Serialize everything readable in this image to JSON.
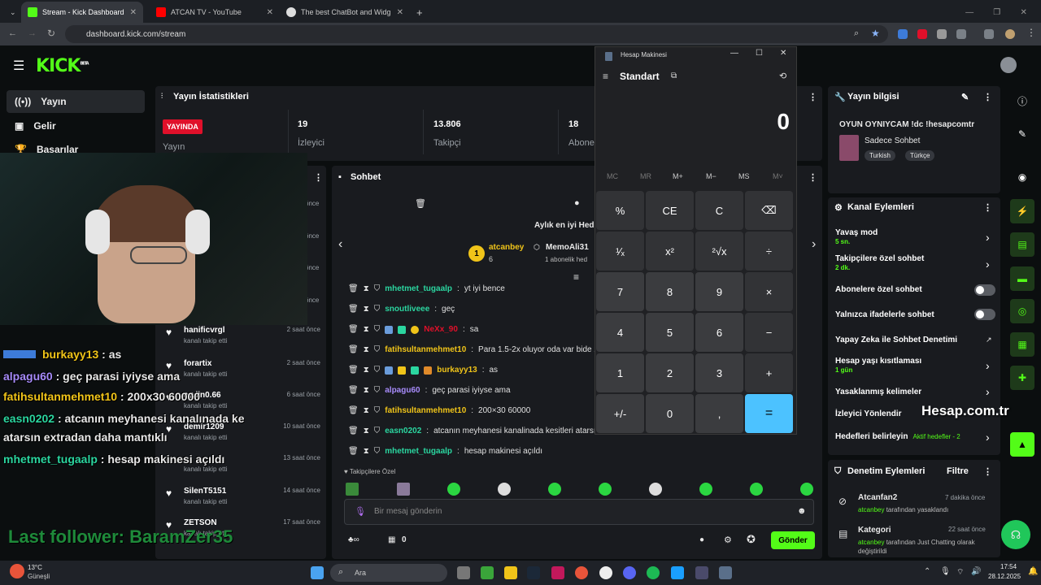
{
  "browser": {
    "tabs": [
      {
        "title": "Stream - Kick Dashboard"
      },
      {
        "title": "ATCAN TV - YouTube"
      },
      {
        "title": "The best ChatBot and Widg"
      }
    ],
    "url": "dashboard.kick.com/stream"
  },
  "kick": {
    "logo": "KICK",
    "logo_sup": "BETA"
  },
  "sidebar": {
    "items": [
      {
        "label": "Yayın",
        "icon": "broadcast-icon"
      },
      {
        "label": "Gelir",
        "icon": "wallet-icon"
      },
      {
        "label": "Başarılar",
        "icon": "trophy-icon"
      }
    ]
  },
  "stats": {
    "title": "Yayın İstatistikleri",
    "live_badge": "YAYINDA",
    "live_label": "Yayın",
    "viewers_value": "19",
    "viewers_label": "İzleyici",
    "followers_value": "13.806",
    "followers_label": "Takipçi",
    "subs_value": "18",
    "subs_label": "Abone"
  },
  "followers": [
    {
      "name": "hanificvrgl",
      "sub": "kanalı takip etti",
      "time": "2 saat önce"
    },
    {
      "name": "forartix",
      "sub": "kanalı takip etti",
      "time": "2 saat önce"
    },
    {
      "name": "aydin0.66",
      "sub": "kanalı takip etti",
      "time": "6 saat önce"
    },
    {
      "name": "demir1209",
      "sub": "kanalı takip etti",
      "time": "10 saat önce"
    },
    {
      "name": "",
      "sub": "kanalı takip etti",
      "time": "13 saat önce"
    },
    {
      "name": "SilenT5151",
      "sub": "kanalı takip etti",
      "time": "14 saat önce"
    },
    {
      "name": "ZETSON",
      "sub": "kanalı takip etti",
      "time": "17 saat önce"
    }
  ],
  "followers_partial_times": [
    "önce",
    "önce",
    "önce",
    "önce"
  ],
  "chat": {
    "title": "Sohbet",
    "top_gifter_title": "Aylık en iyi Hed",
    "gifter1_name": "atcanbey",
    "gifter1_count": "6",
    "gifter2_name": "MemoAli31",
    "gifter2_sub": "1 abonelik hed",
    "messages": [
      {
        "user": "mhetmet_tugaalp",
        "text": "yt iyi bence",
        "color": "#2bd6a0"
      },
      {
        "user": "snoutliveee",
        "text": "geç",
        "color": "#2bd6a0"
      },
      {
        "user": "NeXx_90",
        "text": "sa",
        "color": "#e0102a"
      },
      {
        "user": "fatihsultanmehmet10",
        "text": "Para 1.5-2x oluyor oda var bide 2",
        "color": "#f0c419"
      },
      {
        "user": "burkayy13",
        "text": "as",
        "color": "#f0c419"
      },
      {
        "user": "alpagu60",
        "text": "geç parasi iyiyse ama",
        "color": "#a78bfa"
      },
      {
        "user": "fatihsultanmehmet10",
        "text": "200×30 60000",
        "color": "#f0c419"
      },
      {
        "user": "easn0202",
        "text": "atcanın meyhanesi kanalinada kesitleri atarsı",
        "color": "#2bd6a0"
      },
      {
        "user": "mhetmet_tugaalp",
        "text": "hesap makinesi açıldı",
        "color": "#2bd6a0"
      }
    ],
    "followers_only_label": "Takipçilere Özel",
    "input_placeholder": "Bir mesaj gönderin",
    "points": "0",
    "send_label": "Gönder"
  },
  "overlay": {
    "lines": [
      {
        "user": "burkayy13",
        "text": " : as",
        "color": "#f0c419"
      },
      {
        "user": "alpagu60",
        "text": " : geç parasi iyiyse ama",
        "color": "#a78bfa"
      },
      {
        "user": "fatihsultanmehmet10",
        "text": " : 200x30 60000",
        "color": "#f0c419"
      },
      {
        "user": "easn0202",
        "text": " : atcanın meyhanesi kanalınada ke",
        "color": "#2bd6a0"
      },
      {
        "user": "",
        "text": "atarsın extradan daha mantıklı",
        "color": "#ffffff"
      },
      {
        "user": "mhetmet_tugaalp",
        "text": " : hesap makinesi açıldı",
        "color": "#2bd6a0"
      }
    ],
    "last_follower": "Last follower: BaramZer35"
  },
  "calculator": {
    "title": "Hesap Makinesi",
    "mode": "Standart",
    "display": "0",
    "memory": [
      "MC",
      "MR",
      "M+",
      "M−",
      "MS",
      "M˅"
    ],
    "keys": [
      [
        "%",
        "CE",
        "C",
        "⌫"
      ],
      [
        "¹⁄ₓ",
        "x²",
        "²√x",
        "÷"
      ],
      [
        "7",
        "8",
        "9",
        "×"
      ],
      [
        "4",
        "5",
        "6",
        "−"
      ],
      [
        "1",
        "2",
        "3",
        "+"
      ],
      [
        "+/-",
        "0",
        ",",
        "="
      ]
    ]
  },
  "stream_info": {
    "title": "Yayın bilgisi",
    "stream_title": "OYUN OYNIYCAM !dc !hesapcomtr",
    "category": "Sadece Sohbet",
    "tags": [
      "Turkish",
      "Türkçe"
    ]
  },
  "channel_actions": {
    "title": "Kanal Eylemleri",
    "items": [
      {
        "label": "Yavaş mod",
        "sub": "5 sn."
      },
      {
        "label": "Takipçilere özel sohbet",
        "sub": "2 dk."
      },
      {
        "label": "Abonelere özel sohbet",
        "sub": ""
      },
      {
        "label": "Yalnızca ifadelerle sohbet",
        "sub": ""
      },
      {
        "label": "Yapay Zeka ile Sohbet Denetimi",
        "sub": ""
      },
      {
        "label": "Hesap yaşı kısıtlaması",
        "sub": "1 gün"
      },
      {
        "label": "Yasaklanmış kelimeler",
        "sub": ""
      },
      {
        "label": "İzleyici Yönlendir",
        "sub": ""
      },
      {
        "label": "Hedefleri belirleyin",
        "sub": "Aktif hedefler - 2"
      }
    ]
  },
  "watermark": "Hesap.com.tr",
  "moderation": {
    "title": "Denetim Eylemleri",
    "filter": "Filtre",
    "items": [
      {
        "title": "Atcanfan2",
        "time": "7 dakika önce",
        "actor": "atcanbey",
        "desc": " tarafından yasaklandı"
      },
      {
        "title": "Kategori",
        "time": "22 saat önce",
        "actor": "atcanbey",
        "desc": " tarafından Just Chatting olarak değiştirildi"
      }
    ]
  },
  "taskbar": {
    "weather_temp": "13°C",
    "weather_desc": "Güneşli",
    "search_placeholder": "Ara",
    "time": "17:54",
    "date": "28.12.2025"
  }
}
